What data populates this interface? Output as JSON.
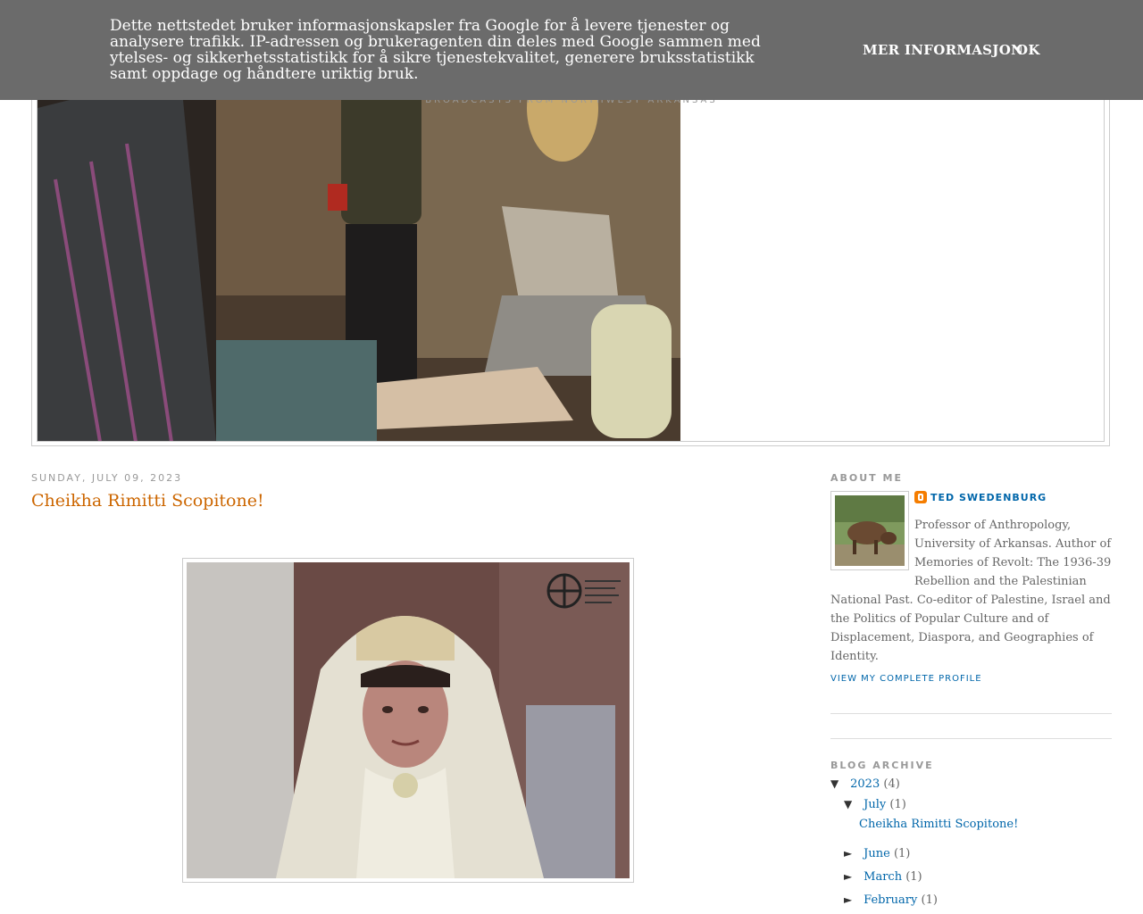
{
  "cookie_banner": {
    "text": "Dette nettstedet bruker informasjonskapsler fra Google for å levere tjenester og analysere trafikk. IP-adressen og brukeragenten din deles med Google sammen med ytelses- og sikkerhetsstatistikk for å sikre tjenestekvalitet, generere bruksstatistikk samt oppdage og håndtere uriktig bruk.",
    "more_label": "MER INFORMASJON",
    "ok_label": "OK"
  },
  "header": {
    "tagline": "Broadcasts from Northwest Arkansas"
  },
  "post": {
    "date": "Sunday, July 09, 2023",
    "title": "Cheikha Rimitti Scopitone!"
  },
  "sidebar": {
    "about_heading": "About Me",
    "profile_name": "Ted Swedenburg",
    "profile_desc_lines": [
      "Professor of Anthropology,",
      "University of Arkansas. Author of",
      "Memories of Revolt: The 1936-39",
      "Rebellion and the Palestinian",
      "National Past. Co-editor of Palestine, Israel and the Politics of Popular Culture and of Displacement, Diaspora, and Geographies of Identity."
    ],
    "view_profile": "View my complete profile",
    "archive_heading": "Blog Archive",
    "archive": {
      "year": {
        "toggle": "▼",
        "label": "2023",
        "count": "(4)"
      },
      "months": [
        {
          "toggle": "▼",
          "label": "July",
          "count": "(1)"
        },
        {
          "toggle": "►",
          "label": "June",
          "count": "(1)"
        },
        {
          "toggle": "►",
          "label": "March",
          "count": "(1)"
        },
        {
          "toggle": "►",
          "label": "February",
          "count": "(1)"
        }
      ],
      "july_post": "Cheikha Rimitti Scopitone!"
    }
  }
}
